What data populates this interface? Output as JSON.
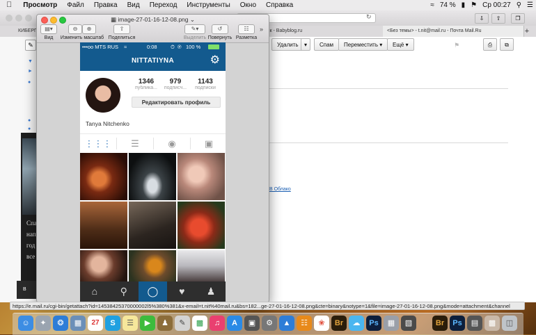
{
  "menubar": {
    "apple": "",
    "app": "Просмотр",
    "items": [
      "Файл",
      "Правка",
      "Вид",
      "Переход",
      "Инструменты",
      "Окно",
      "Справка"
    ],
    "battery": "74 %",
    "clock": "Ср 00:27"
  },
  "browser": {
    "url": "il.ru",
    "tabs": [
      "КИБЕРП",
      "вник - Babyblog.ru",
      "<Без темы> - t.nit@mail.ru - Почта Mail.Ru"
    ],
    "buttons": {
      "delete": "Удалить",
      "spam": "Спам",
      "move": "Переместить",
      "more": "Ещё"
    },
    "link_cloud": "В Облако",
    "dark_snippet": [
      "Спа",
      "нап",
      "год",
      "все"
    ],
    "dark_btn": "В"
  },
  "preview": {
    "title": "image-27-01-16-12-08.png",
    "tools": {
      "view": "Вид",
      "zoom": "Изменить масштаб",
      "share": "Поделиться",
      "highlight": "Выделить",
      "rotate": "Повернуть",
      "markup": "Разметка"
    }
  },
  "instagram": {
    "status": {
      "carrier": "•••oo MTS RUS",
      "time": "0:08",
      "battery": "100 %"
    },
    "username": "NITTATIYNA",
    "stats": [
      {
        "value": "1346",
        "label": "публика..."
      },
      {
        "value": "979",
        "label": "подписч..."
      },
      {
        "value": "1143",
        "label": "подписки"
      }
    ],
    "edit_profile": "Редактировать профиль",
    "full_name": "Tanya Nitchenko"
  },
  "status_link": "https://e.mail.ru/cgi-bin/getattach?id=14538425370000002l5%380%381&x-email=t.nit%40mail.ru&bs=182...ge-27-01-16-12-08.png&cte=binary&notype=1&file=image-27-01-16-12-08.png&mode=attachment&channel",
  "dock": {
    "calendar_day": "27"
  }
}
